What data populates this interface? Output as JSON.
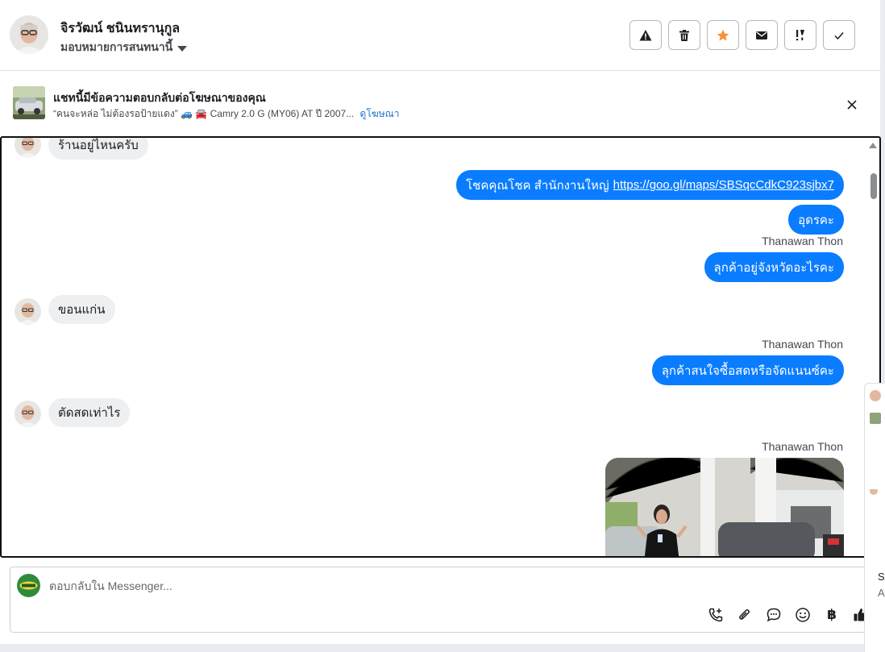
{
  "contact": {
    "name": "จิรวัฒน์ ชนินทรานุกูล",
    "assign_label": "มอบหมายการสนทนานี้"
  },
  "header_actions": [
    {
      "icon": "warning-icon"
    },
    {
      "icon": "trash-icon"
    },
    {
      "icon": "star-icon"
    },
    {
      "icon": "mail-icon"
    },
    {
      "icon": "important-icon"
    },
    {
      "icon": "check-icon"
    }
  ],
  "ad_banner": {
    "title": "แชทนี้มีข้อความตอบกลับต่อโฆษณาของคุณ",
    "subtitle": "“คนจะหล่อ ไม่ต้องรอป้ายแดง” 🚙 🚘 Camry 2.0 G (MY06) AT ปี 2007...",
    "link_label": "ดูโฆษณา"
  },
  "messages": {
    "m1": "ร้านอยู่ไหนครับ",
    "m2_text": "โชคคุณโชค สำนักงานใหญ่",
    "m2_link": "https://goo.gl/maps/SBSqcCdkC923sjbx7",
    "m3": "อุดรคะ",
    "sender1": "Thanawan Thon",
    "m4": "ลุกค้าอยู่จังหวัดอะไรคะ",
    "m5": "ขอนแก่น",
    "sender2": "Thanawan Thon",
    "m6": "ลุกค้าสนใจซื้อสดหรือจัดแนนซ์คะ",
    "m7": "ตัดสดเท่าไร",
    "sender3": "Thanawan Thon"
  },
  "composer": {
    "placeholder": "ตอบกลับใน Messenger..."
  },
  "tools": [
    {
      "icon": "call-add-icon"
    },
    {
      "icon": "attachment-icon"
    },
    {
      "icon": "chat-bubble-icon"
    },
    {
      "icon": "emoji-icon"
    },
    {
      "icon": "baht-icon",
      "glyph": "฿"
    },
    {
      "icon": "thumbs-up-icon"
    }
  ],
  "side_widget": {
    "text1": "So",
    "text2": "A"
  },
  "colors": {
    "bubble_out": "#0a7cff",
    "bubble_in": "#eeeff1",
    "star": "#f7923a",
    "link": "#1a73c9"
  }
}
